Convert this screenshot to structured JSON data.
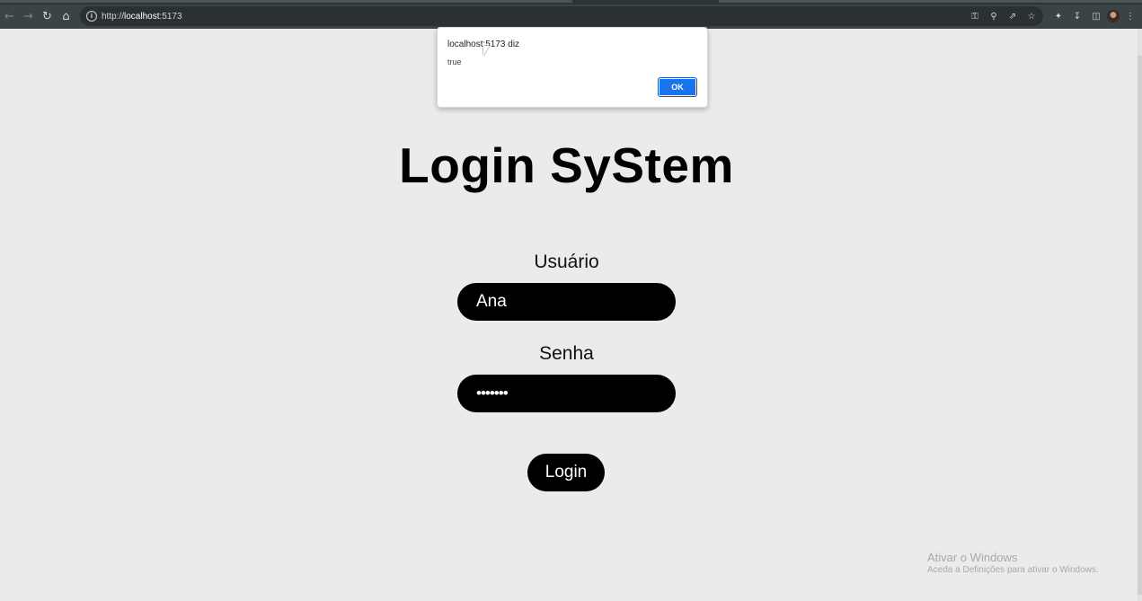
{
  "browser": {
    "url_prefix": "http://",
    "url_host": "localhost",
    "url_suffix": ":5173",
    "icons": [
      "back-icon",
      "forward-icon",
      "reload-icon",
      "home-icon",
      "info-icon",
      "key-icon",
      "zoom-icon",
      "share-icon",
      "star-icon",
      "extensions-icon",
      "download-icon",
      "sidepanel-icon",
      "avatar",
      "menu-icon"
    ]
  },
  "dialog": {
    "title": "localhost:5173 diz",
    "message": "true",
    "ok_label": "OK"
  },
  "page": {
    "title": "Login SyStem",
    "user_label": "Usuário",
    "user_value": "Ana",
    "password_label": "Senha",
    "password_value": "•••••••",
    "login_label": "Login"
  },
  "watermark": {
    "line1": "Ativar o Windows",
    "line2": "Aceda a Definições para ativar o Windows."
  },
  "colors": {
    "background": "#ebebeb",
    "pill": "#000000",
    "ok_button": "#1a73e8",
    "toolbar": "#3c4347"
  }
}
